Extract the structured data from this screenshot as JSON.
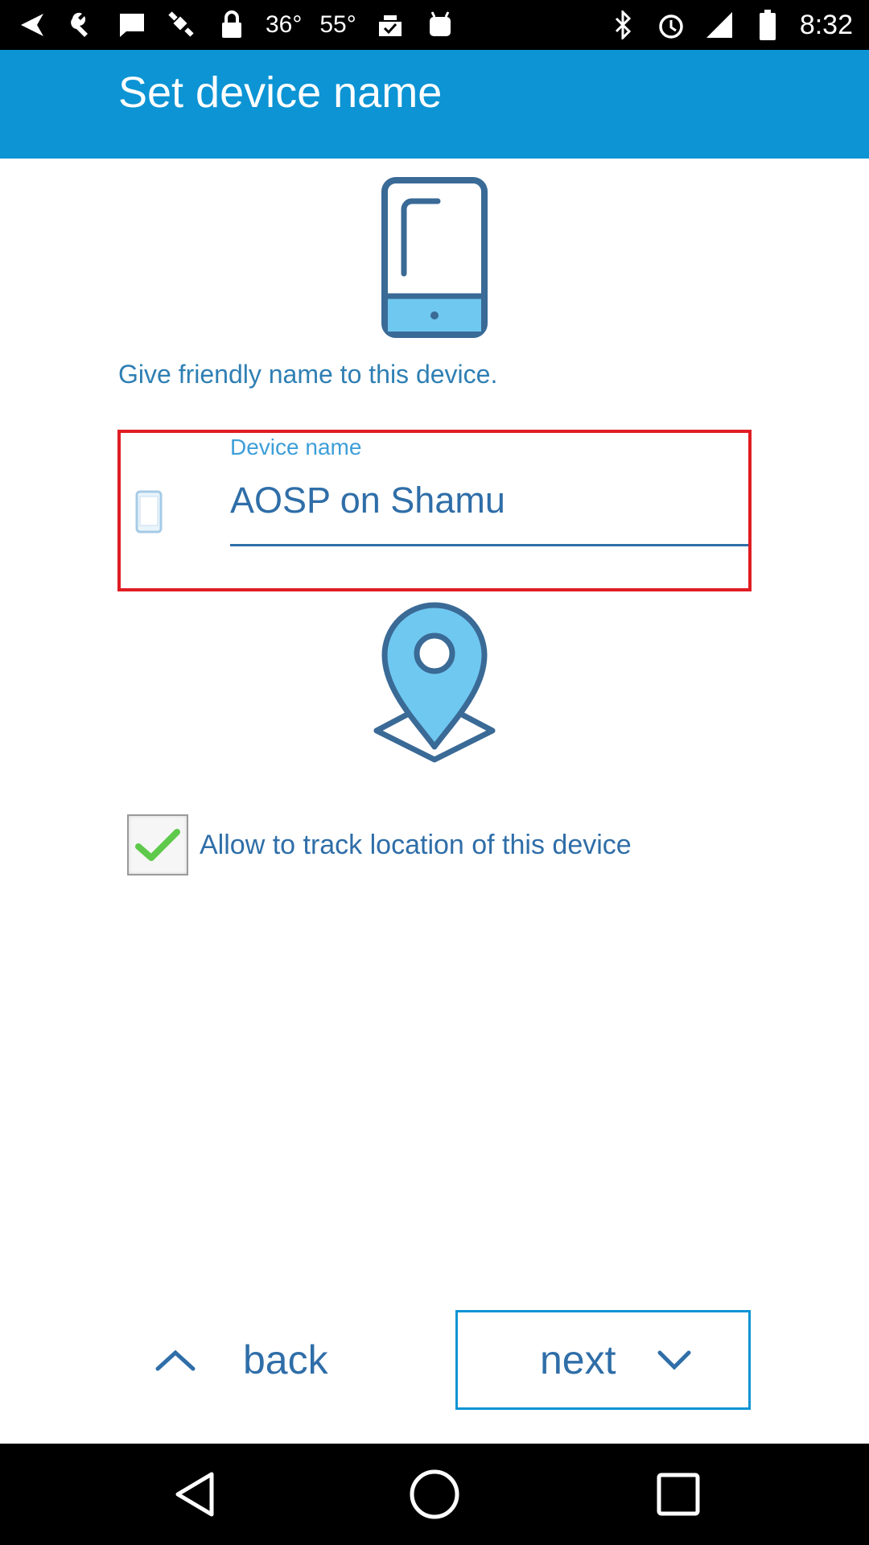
{
  "status_bar": {
    "temp1": "36°",
    "temp2": "55°",
    "time": "8:32",
    "icons": [
      "back-arrow-icon",
      "wrench-icon",
      "message-icon",
      "gps-satellite-icon",
      "lock-icon",
      "clipboard-check-icon",
      "android-icon",
      "bluetooth-icon",
      "alarm-icon",
      "signal-icon",
      "battery-icon"
    ]
  },
  "app_bar": {
    "title": "Set device name"
  },
  "hint": "Give friendly name to this device.",
  "device_field": {
    "label": "Device name",
    "value": "AOSP on Shamu"
  },
  "location": {
    "checkbox_label": "Allow to track location of this device",
    "checked": true
  },
  "buttons": {
    "back": "back",
    "next": "next"
  },
  "colors": {
    "primary": "#0c94d4",
    "text": "#2f6ea8",
    "highlight": "#e01d23"
  }
}
